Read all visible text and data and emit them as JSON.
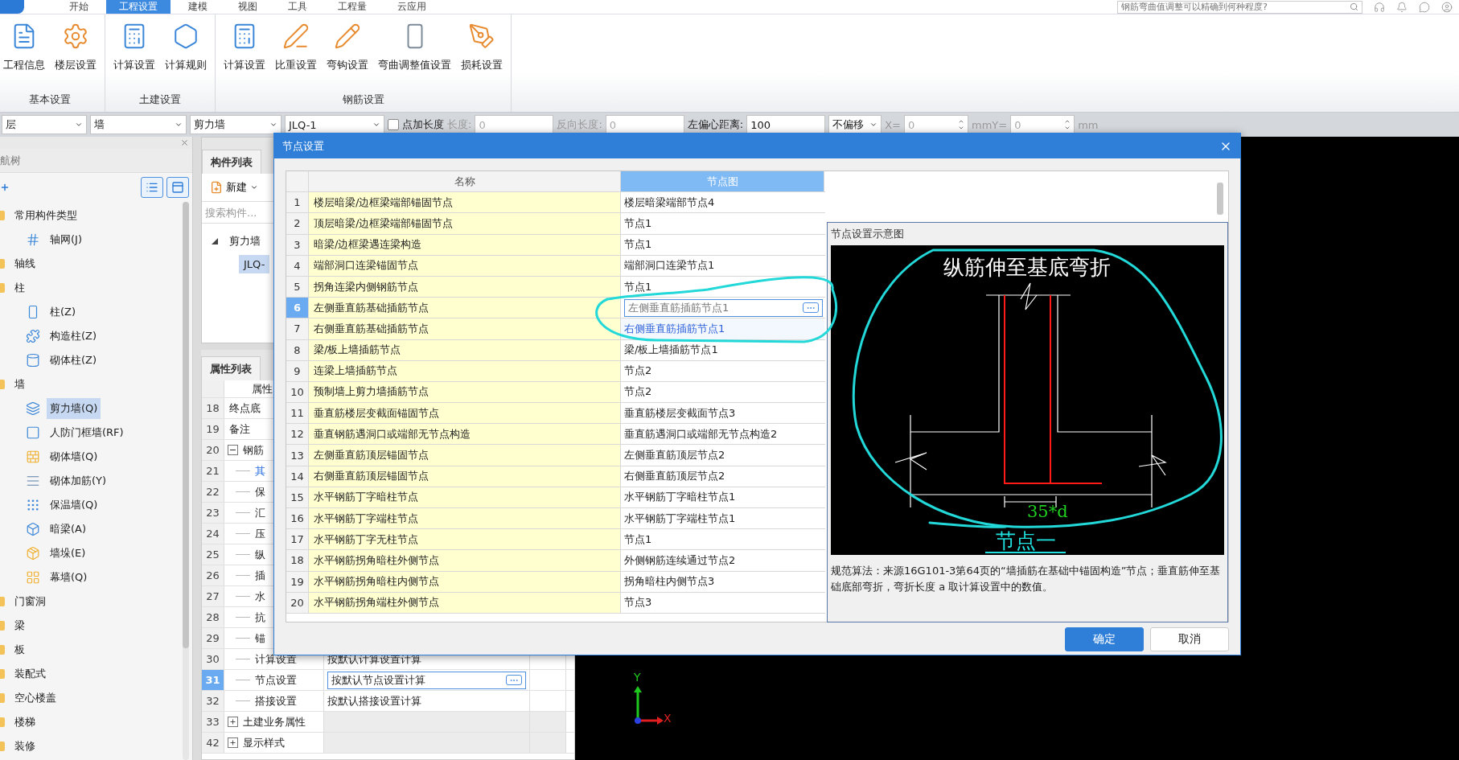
{
  "app_tabs": [
    {
      "label": "开始",
      "selected": false
    },
    {
      "label": "工程设置",
      "selected": true
    },
    {
      "label": "建模",
      "selected": false
    },
    {
      "label": "视图",
      "selected": false
    },
    {
      "label": "工具",
      "selected": false
    },
    {
      "label": "工程量",
      "selected": false
    },
    {
      "label": "云应用",
      "selected": false
    }
  ],
  "help_search": {
    "placeholder": "钢筋弯曲值调整可以精确到何种程度?"
  },
  "ribbon": {
    "groups": [
      {
        "title": "基本设置",
        "buttons": [
          "工程信息",
          "楼层设置"
        ]
      },
      {
        "title": "土建设置",
        "buttons": [
          "计算设置",
          "计算规则"
        ]
      },
      {
        "title": "钢筋设置",
        "buttons": [
          "计算设置",
          "比重设置",
          "弯钩设置",
          "弯曲调整值设置",
          "损耗设置"
        ]
      }
    ]
  },
  "toolbar": [
    {
      "kind": "dropdown",
      "value": "层"
    },
    {
      "kind": "dropdown",
      "value": "墙"
    },
    {
      "kind": "dropdown",
      "value": "剪力墙"
    },
    {
      "kind": "dropdown",
      "value": "JLQ-1"
    },
    {
      "kind": "checkbox",
      "label": "点加长度",
      "checked": false
    },
    {
      "kind": "field",
      "label": "长度:",
      "value": "0",
      "disabled": true
    },
    {
      "kind": "field",
      "label": "反向长度:",
      "value": "0",
      "disabled": true
    },
    {
      "kind": "field",
      "label": "左偏心距离:",
      "value": "100",
      "disabled": false
    },
    {
      "kind": "dropdown",
      "value": "不偏移"
    },
    {
      "kind": "spinner",
      "label": "X=",
      "value": "0",
      "disabled": true
    },
    {
      "kind": "spinner",
      "label": "mmY=",
      "value": "0",
      "disabled": true
    },
    {
      "kind": "text",
      "label": "mm",
      "disabled": true
    }
  ],
  "nav": {
    "title": "航树",
    "items": [
      {
        "label": "常用构件类型",
        "children": [
          {
            "label": "轴网(J)",
            "selected": false
          }
        ]
      },
      {
        "label": "轴线"
      },
      {
        "label": "柱",
        "children": [
          {
            "label": "柱(Z)",
            "selected": false
          },
          {
            "label": "构造柱(Z)",
            "selected": false
          },
          {
            "label": "砌体柱(Z)",
            "selected": false
          }
        ]
      },
      {
        "label": "墙",
        "children": [
          {
            "label": "剪力墙(Q)",
            "selected": true
          },
          {
            "label": "人防门框墙(RF)",
            "selected": false
          },
          {
            "label": "砌体墙(Q)",
            "selected": false
          },
          {
            "label": "砌体加筋(Y)",
            "selected": false
          },
          {
            "label": "保温墙(Q)",
            "selected": false
          },
          {
            "label": "暗梁(A)",
            "selected": false
          },
          {
            "label": "墙垛(E)",
            "selected": false
          },
          {
            "label": "幕墙(Q)",
            "selected": false
          }
        ]
      },
      {
        "label": "门窗洞"
      },
      {
        "label": "梁"
      },
      {
        "label": "板"
      },
      {
        "label": "装配式"
      },
      {
        "label": "空心楼盖"
      },
      {
        "label": "楼梯"
      },
      {
        "label": "装修"
      }
    ]
  },
  "component_list": {
    "tab": "构件列表",
    "new_button": "新建",
    "search": {
      "placeholder": "搜索构件..."
    },
    "tree": [
      {
        "label": "剪力墙",
        "children": [
          {
            "label": "JLQ-",
            "selected": true
          }
        ]
      }
    ]
  },
  "properties": {
    "tab": "属性列表",
    "header": "属性",
    "rows": [
      {
        "num": "18",
        "name": "终点底",
        "kind": "field",
        "selected": false
      },
      {
        "num": "19",
        "name": "备注",
        "kind": "field",
        "selected": false
      },
      {
        "num": "20",
        "name": "钢筋",
        "kind": "group",
        "expanded": true,
        "selected": false
      },
      {
        "num": "21",
        "name": "其",
        "kind": "link",
        "selected": false
      },
      {
        "num": "22",
        "name": "保",
        "kind": "sub",
        "selected": false
      },
      {
        "num": "23",
        "name": "汇",
        "kind": "sub",
        "selected": false
      },
      {
        "num": "24",
        "name": "压",
        "kind": "sub",
        "selected": false
      },
      {
        "num": "25",
        "name": "纵",
        "kind": "sub",
        "selected": false
      },
      {
        "num": "26",
        "name": "插",
        "kind": "sub",
        "selected": false
      },
      {
        "num": "27",
        "name": "水",
        "kind": "sub",
        "selected": false
      },
      {
        "num": "28",
        "name": "抗",
        "kind": "sub",
        "selected": false
      },
      {
        "num": "29",
        "name": "锚",
        "kind": "sub",
        "selected": false
      },
      {
        "num": "30",
        "name": "计算设置",
        "value": "按默认计算设置计算",
        "kind": "sub",
        "selected": false
      },
      {
        "num": "31",
        "name": "节点设置",
        "value": "按默认节点设置计算",
        "kind": "sub",
        "selected": true
      },
      {
        "num": "32",
        "name": "搭接设置",
        "value": "按默认搭接设置计算",
        "kind": "sub",
        "selected": false
      },
      {
        "num": "33",
        "name": "土建业务属性",
        "kind": "group",
        "expanded": false,
        "selected": false
      },
      {
        "num": "42",
        "name": "显示样式",
        "kind": "group",
        "expanded": false,
        "selected": false
      }
    ]
  },
  "canvas": {
    "axis_y": "Y",
    "axis_x": "X"
  },
  "dialog": {
    "title": "节点设置",
    "columns": [
      {
        "label": "名称",
        "selected": false
      },
      {
        "label": "节点图",
        "selected": true
      }
    ],
    "rows": [
      {
        "num": "1",
        "name": "楼层暗梁/边框梁端部锚固节点",
        "value": "楼层暗梁端部节点4",
        "selected": false,
        "hovered": false
      },
      {
        "num": "2",
        "name": "顶层暗梁/边框梁端部锚固节点",
        "value": "节点1",
        "selected": false,
        "hovered": false
      },
      {
        "num": "3",
        "name": "暗梁/边框梁遇连梁构造",
        "value": "节点1",
        "selected": false,
        "hovered": false
      },
      {
        "num": "4",
        "name": "端部洞口连梁锚固节点",
        "value": "端部洞口连梁节点1",
        "selected": false,
        "hovered": false
      },
      {
        "num": "5",
        "name": "拐角连梁内侧钢筋节点",
        "value": "节点1",
        "selected": false,
        "hovered": false
      },
      {
        "num": "6",
        "name": "左侧垂直筋基础插筋节点",
        "value": "左侧垂直筋插筋节点1",
        "selected": true,
        "hovered": false
      },
      {
        "num": "7",
        "name": "右侧垂直筋基础插筋节点",
        "value": "右侧垂直筋插筋节点1",
        "selected": false,
        "hovered": true
      },
      {
        "num": "8",
        "name": "梁/板上墙插筋节点",
        "value": "梁/板上墙插筋节点1",
        "selected": false,
        "hovered": false
      },
      {
        "num": "9",
        "name": "连梁上墙插筋节点",
        "value": "节点2",
        "selected": false,
        "hovered": false
      },
      {
        "num": "10",
        "name": "预制墙上剪力墙插筋节点",
        "value": "节点2",
        "selected": false,
        "hovered": false
      },
      {
        "num": "11",
        "name": "垂直筋楼层变截面锚固节点",
        "value": "垂直筋楼层变截面节点3",
        "selected": false,
        "hovered": false
      },
      {
        "num": "12",
        "name": "垂直钢筋遇洞口或端部无节点构造",
        "value": "垂直筋遇洞口或端部无节点构造2",
        "selected": false,
        "hovered": false
      },
      {
        "num": "13",
        "name": "左侧垂直筋顶层锚固节点",
        "value": "左侧垂直筋顶层节点2",
        "selected": false,
        "hovered": false
      },
      {
        "num": "14",
        "name": "右侧垂直筋顶层锚固节点",
        "value": "右侧垂直筋顶层节点2",
        "selected": false,
        "hovered": false
      },
      {
        "num": "15",
        "name": "水平钢筋丁字暗柱节点",
        "value": "水平钢筋丁字暗柱节点1",
        "selected": false,
        "hovered": false
      },
      {
        "num": "16",
        "name": "水平钢筋丁字端柱节点",
        "value": "水平钢筋丁字端柱节点1",
        "selected": false,
        "hovered": false
      },
      {
        "num": "17",
        "name": "水平钢筋丁字无柱节点",
        "value": "节点1",
        "selected": false,
        "hovered": false
      },
      {
        "num": "18",
        "name": "水平钢筋拐角暗柱外侧节点",
        "value": "外侧钢筋连续通过节点2",
        "selected": false,
        "hovered": false
      },
      {
        "num": "19",
        "name": "水平钢筋拐角暗柱内侧节点",
        "value": "拐角暗柱内侧节点3",
        "selected": false,
        "hovered": false
      },
      {
        "num": "20",
        "name": "水平钢筋拐角端柱外侧节点",
        "value": "节点3",
        "selected": false,
        "hovered": false
      }
    ],
    "diagram": {
      "title": "节点设置示意图",
      "heading": "纵筋伸至基底弯折",
      "dimension": "35*d",
      "caption": "节点一",
      "description": "规范算法：来源16G101-3第64页的“墙插筋在基础中锚固构造”节点；垂直筋伸至基础底部弯折，弯折长度 a 取计算设置中的数值。"
    },
    "buttons": [
      {
        "label": "确定",
        "primary": true
      },
      {
        "label": "取消",
        "primary": false
      }
    ]
  }
}
